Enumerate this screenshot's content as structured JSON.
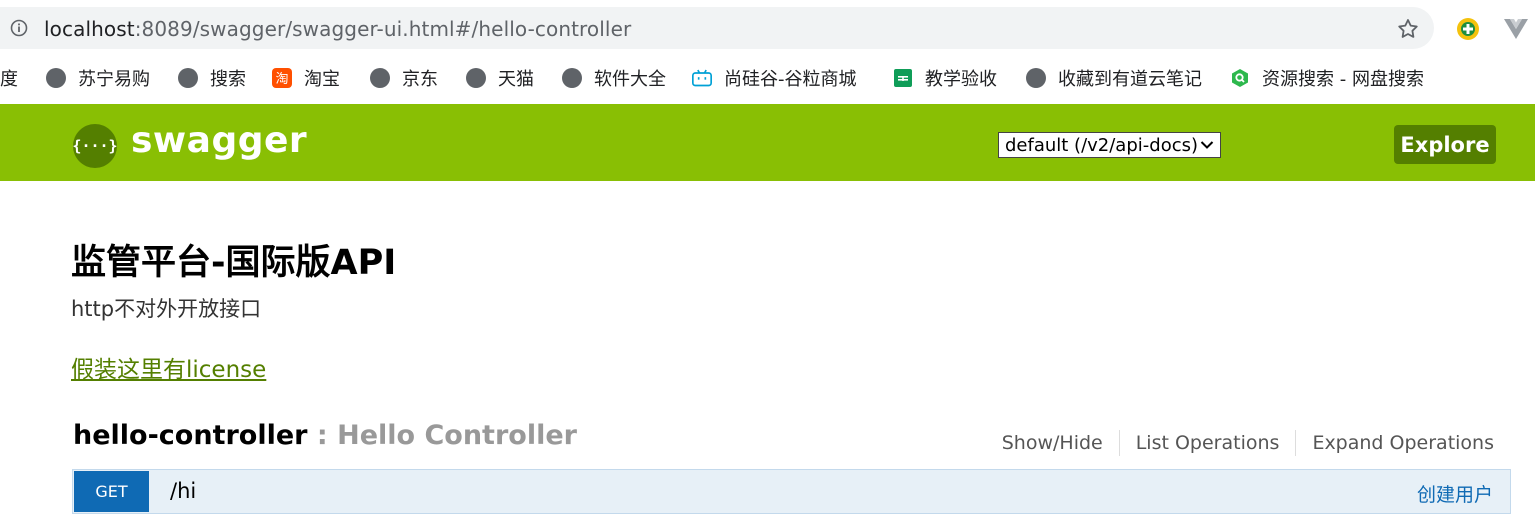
{
  "browser": {
    "url_host": "localhost",
    "url_rest": ":8089/swagger/swagger-ui.html#/hello-controller",
    "icons": {
      "info": "info-icon",
      "star": "star-icon",
      "ext1": "extension-icon",
      "ext2": "vue-devtools-icon"
    }
  },
  "bookmarks": [
    {
      "label": "度",
      "icon": "none"
    },
    {
      "label": "苏宁易购",
      "icon": "globe-icon"
    },
    {
      "label": "搜索",
      "icon": "globe-icon"
    },
    {
      "label": "淘宝",
      "icon": "taobao-icon"
    },
    {
      "label": "京东",
      "icon": "globe-icon"
    },
    {
      "label": "天猫",
      "icon": "globe-icon"
    },
    {
      "label": "软件大全",
      "icon": "globe-icon"
    },
    {
      "label": "尚硅谷-谷粒商城",
      "icon": "bilibili-icon"
    },
    {
      "label": "教学验收",
      "icon": "sheet-icon"
    },
    {
      "label": "收藏到有道云笔记",
      "icon": "globe-icon"
    },
    {
      "label": "资源搜索 - 网盘搜索",
      "icon": "search-green-icon"
    }
  ],
  "header": {
    "logo_glyph": "{···}",
    "logo_text": "swagger",
    "select_value": "default (/v2/api-docs)",
    "explore_label": "Explore",
    "brand_color": "#89bf04"
  },
  "info": {
    "title": "监管平台-国际版API",
    "description": "http不对外开放接口",
    "license": "假装这里有license"
  },
  "resource": {
    "name": "hello-controller",
    "separator": " : ",
    "description": "Hello Controller",
    "ops": [
      "Show/Hide",
      "List Operations",
      "Expand Operations"
    ]
  },
  "endpoint": {
    "method": "GET",
    "path": "/hi",
    "summary": "创建用户",
    "method_color": "#0f6ab4"
  }
}
